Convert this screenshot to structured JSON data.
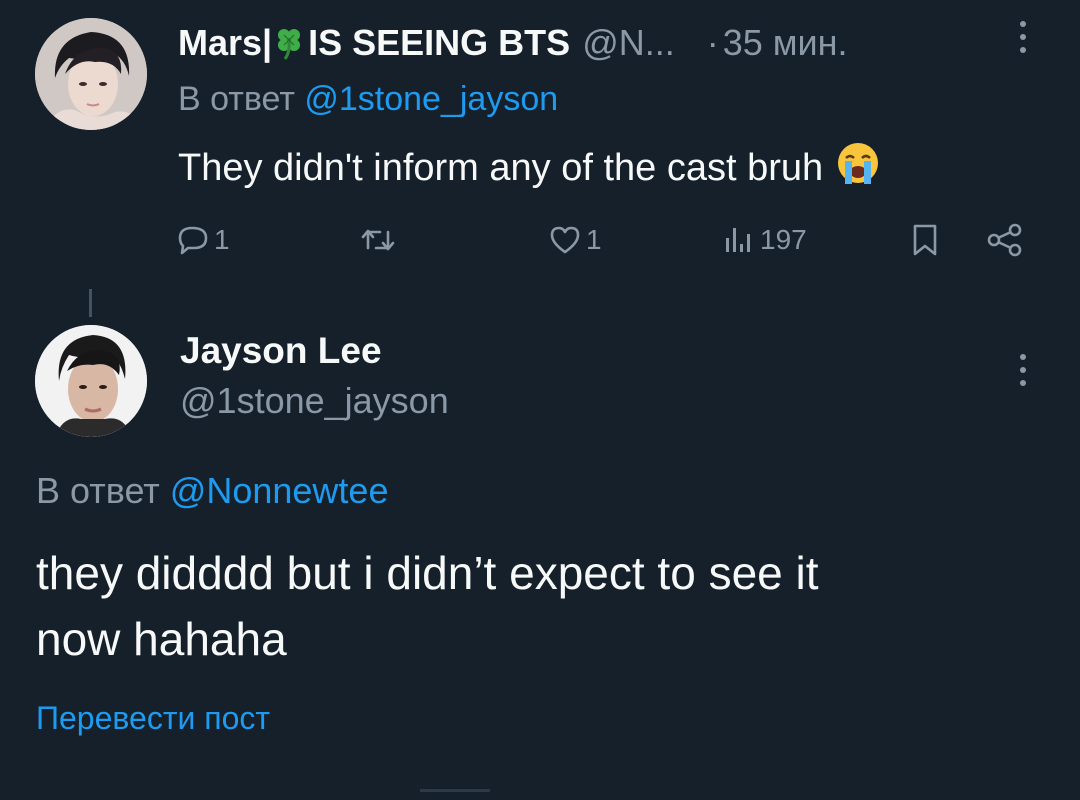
{
  "reply_tweet": {
    "author": {
      "display_name": "Mars|",
      "display_name_suffix": "IS SEEING BTS",
      "handle_truncated": "@N...",
      "emoji_name": "four-leaf-clover-icon"
    },
    "separator": "·",
    "time": "35 мин.",
    "reply_prefix": "В ответ",
    "reply_to": "@1stone_jayson",
    "text": "They didn't inform any of the cast bruh",
    "trailing_emoji": "loudly-crying-face-icon",
    "actions": {
      "reply_count": "1",
      "retweet_count": "",
      "like_count": "1",
      "views_count": "197"
    }
  },
  "main_tweet": {
    "author": {
      "display_name": "Jayson Lee",
      "handle": "@1stone_jayson"
    },
    "reply_prefix": "В ответ",
    "reply_to": "@Nonnewtee",
    "text_line_1": "they didddd but i didn’t expect to see it",
    "text_line_2": "now hahaha",
    "translate_label": "Перевести пост"
  },
  "colors": {
    "background": "#15202b",
    "text": "#f7f9f9",
    "muted": "#8b98a5",
    "accent": "#1d9bf0"
  }
}
